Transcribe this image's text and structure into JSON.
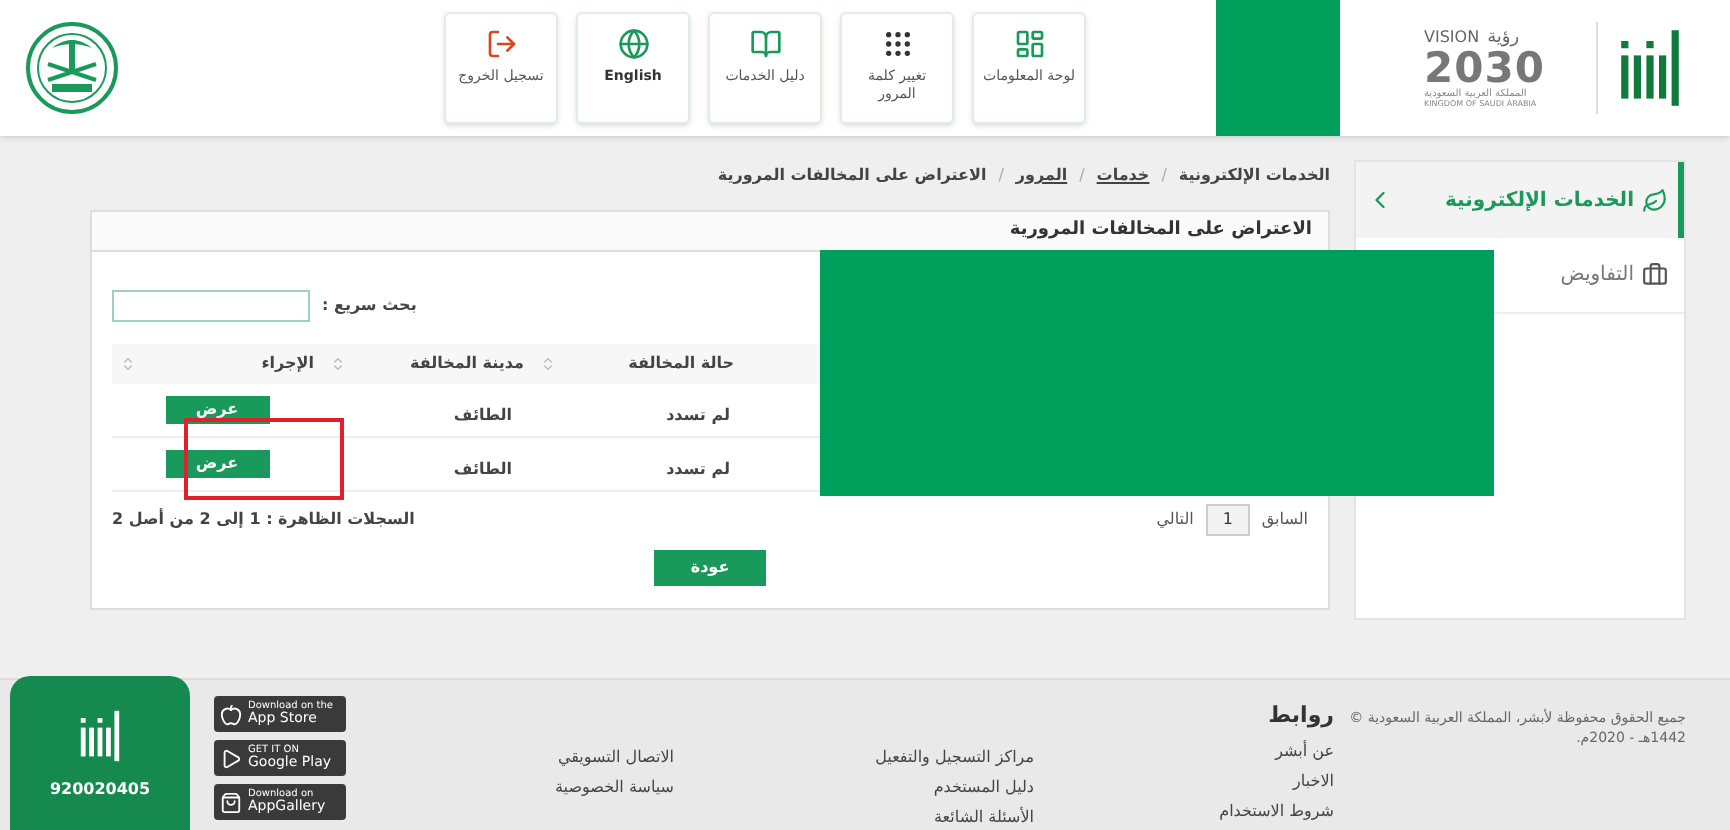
{
  "header": {
    "vision": {
      "word": "VISION",
      "arabic": "رؤية",
      "year": "2030",
      "country_ar": "المملكة العربية السعودية",
      "country_en": "KINGDOM OF SAUDI ARABIA"
    },
    "nav": [
      {
        "kind": "dashboard",
        "label": "لوحة المعلومات"
      },
      {
        "kind": "keypad",
        "label": "تغيير كلمة المرور"
      },
      {
        "kind": "book",
        "label": "دليل الخدمات"
      },
      {
        "kind": "globe",
        "label": "English"
      },
      {
        "kind": "logout",
        "label": "تسجيل الخروج"
      }
    ]
  },
  "breadcrumb": [
    {
      "label": "الخدمات الإلكترونية",
      "link": false
    },
    {
      "separator": "/",
      "label": "خدمات",
      "link": true
    },
    {
      "separator": "/",
      "label": "المرور",
      "link": true
    },
    {
      "separator": "/",
      "label": "الاعتراض على المخالفات المرورية",
      "link": false
    }
  ],
  "sidebar": {
    "items": [
      {
        "kind": "services",
        "label": "الخدمات الإلكترونية",
        "selected": true
      },
      {
        "kind": "briefcase",
        "label": "التفاويض",
        "selected": false
      }
    ]
  },
  "panel": {
    "title": "الاعتراض على المخالفات المرورية",
    "search": {
      "label": "بحث سريع :"
    },
    "columns": [
      "حالة المخالفة",
      "مدينة المخالفة",
      "الإجراء"
    ],
    "rows": [
      {
        "status": "لم تسدد",
        "city": "الطائف",
        "action": "عرض"
      },
      {
        "status": "لم تسدد",
        "city": "الطائف",
        "action": "عرض"
      }
    ],
    "pagination": {
      "previous": "السابق",
      "pages": [
        {
          "label": "1",
          "selected": true
        }
      ],
      "next": "التالي"
    },
    "records": "السجلات الظاهرة : 1 إلى 2 من أصل 2",
    "back": "عودة"
  },
  "footer": {
    "copyright": "جميع الحقوق محفوظة لأبشر، المملكة العربية السعودية © 1442هـ - 2020م.",
    "links_title": "روابط",
    "columns": [
      [
        "عن أبشر",
        "الاخبار",
        "شروط الاستخدام"
      ],
      [
        "مراكز التسجيل والتفعيل",
        "دليل المستخدم",
        "الأسئلة الشائعة"
      ],
      [
        "الاتصال التسويقي",
        "سياسة الخصوصية"
      ]
    ],
    "stores": [
      {
        "kind": "apple",
        "small": "Download on the",
        "name": "App Store"
      },
      {
        "kind": "google",
        "small": "GET IT ON",
        "name": "Google Play"
      },
      {
        "kind": "huawei",
        "small": "Download on",
        "name": "AppGallery"
      }
    ],
    "phone": "920020405"
  }
}
